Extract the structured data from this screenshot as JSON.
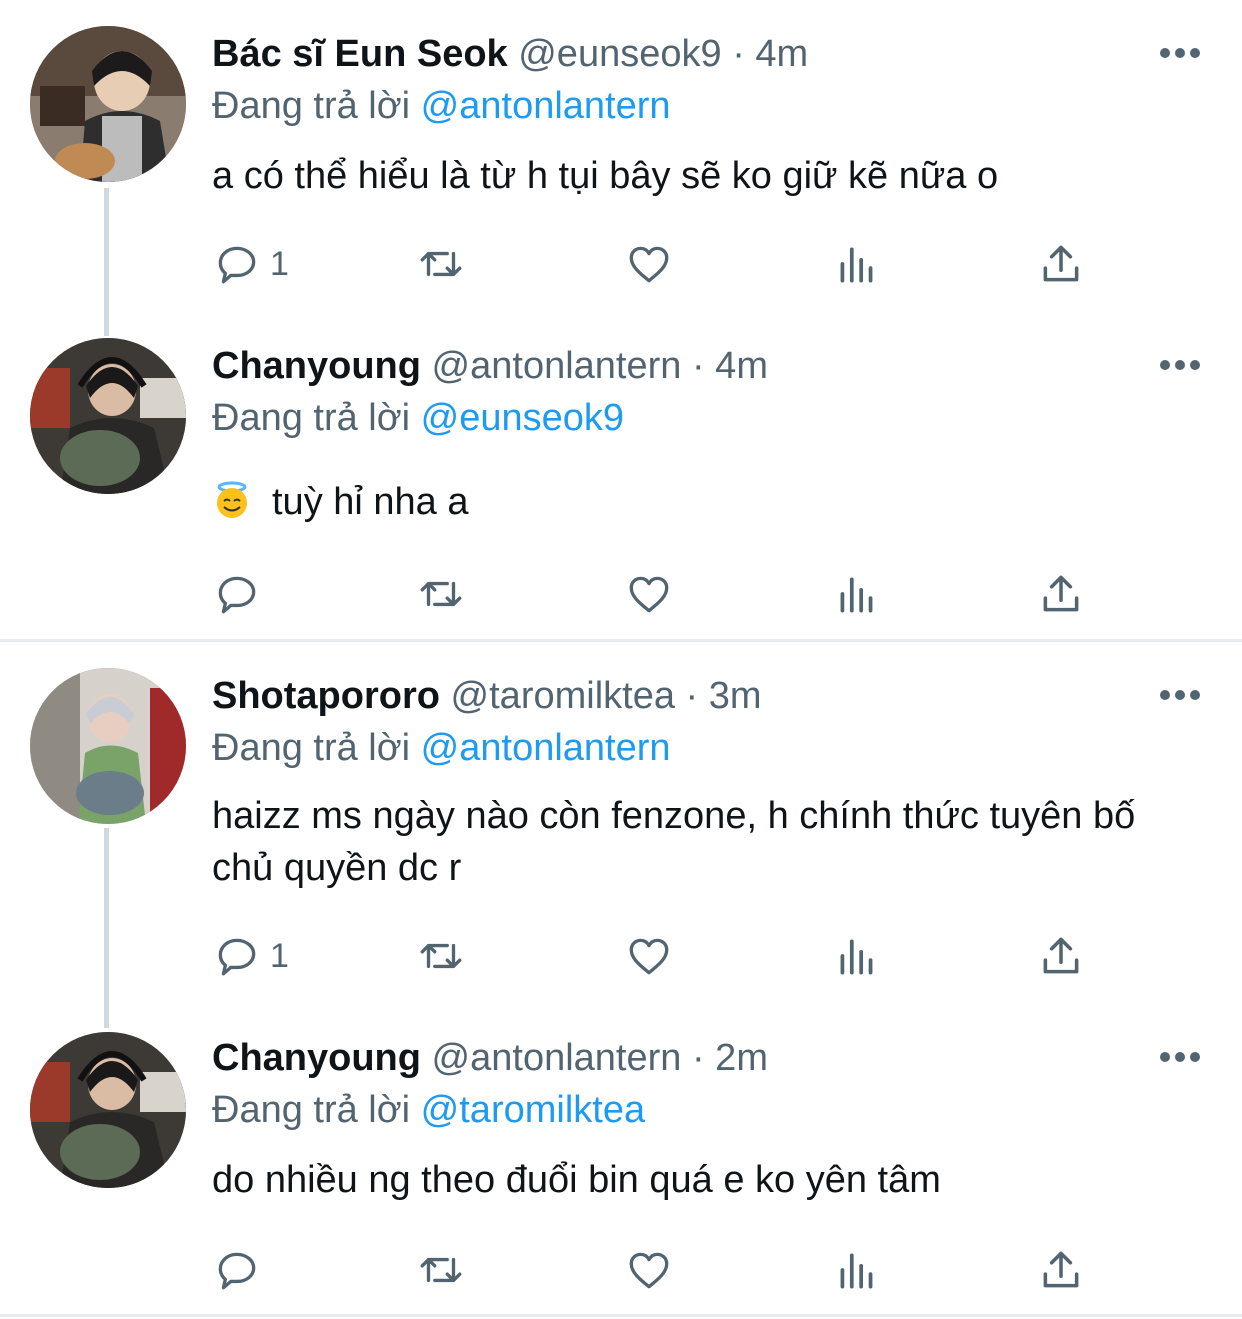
{
  "tweets": [
    {
      "name": "Bác sĩ Eun Seok",
      "handle": "@eunseok9",
      "time": "· 4m",
      "replying_prefix": "Đang trả lời",
      "replying_to": "@antonlantern",
      "text": "a có thể hiểu là từ h tụi bây sẽ ko giữ kẽ nữa o",
      "reply_count": "1",
      "avatar_icon": "avatar-photo"
    },
    {
      "name": "Chanyoung",
      "handle": "@antonlantern",
      "time": "· 4m",
      "replying_prefix": "Đang trả lời",
      "replying_to": "@eunseok9",
      "emoji": "smiling-face-with-halo",
      "text": "tuỳ hỉ nha a",
      "reply_count": "",
      "avatar_icon": "avatar-photo"
    },
    {
      "name": "Shotapororo",
      "handle": "@taromilktea",
      "time": "· 3m",
      "replying_prefix": "Đang trả lời",
      "replying_to": "@antonlantern",
      "text": "haizz ms ngày nào còn fenzone, h chính thức tuyên bố chủ quyền dc r",
      "reply_count": "1",
      "avatar_icon": "avatar-photo"
    },
    {
      "name": "Chanyoung",
      "handle": "@antonlantern",
      "time": "· 2m",
      "replying_prefix": "Đang trả lời",
      "replying_to": "@taromilktea",
      "text": "do nhiều ng theo đuổi bin quá e ko yên tâm",
      "reply_count": "",
      "avatar_icon": "avatar-photo"
    }
  ],
  "icons": {
    "reply": "reply-icon",
    "retweet": "retweet-icon",
    "like": "heart-icon",
    "views": "analytics-icon",
    "share": "share-icon",
    "more": "more-icon"
  },
  "colors": {
    "text": "#0f1419",
    "secondary": "#536471",
    "accent": "#1d9bf0",
    "thread_line": "#cfd9de"
  }
}
